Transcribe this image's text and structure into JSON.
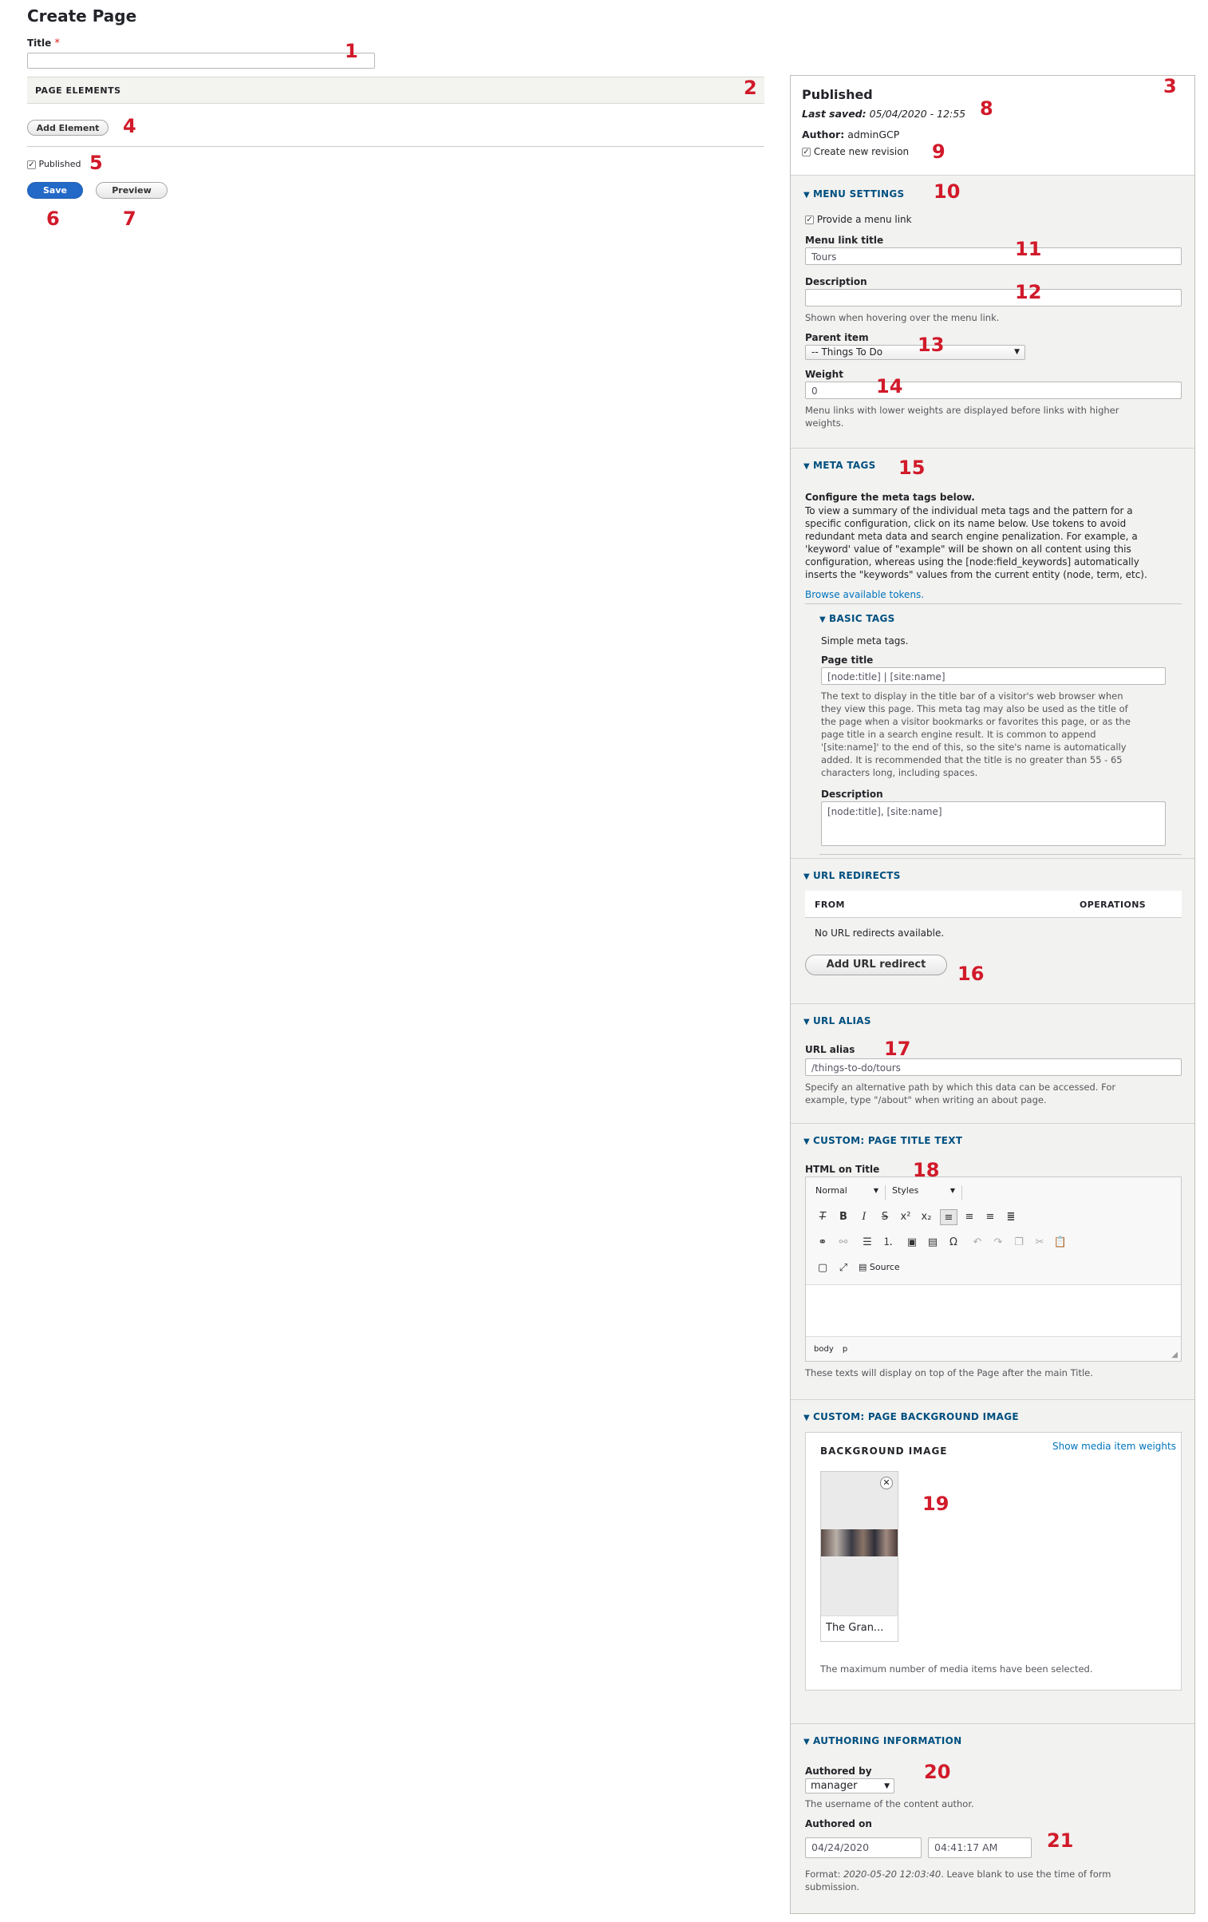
{
  "page": {
    "title": "Create Page",
    "title_label": "Title",
    "required_mark": "*",
    "page_elements_label": "PAGE ELEMENTS",
    "add_element_label": "Add Element",
    "published_label": "Published",
    "published_checked": true,
    "save_label": "Save",
    "preview_label": "Preview"
  },
  "meta": {
    "status": "Published",
    "last_saved_label": "Last saved:",
    "last_saved_value": "05/04/2020 - 12:55",
    "author_label": "Author:",
    "author_value": "adminGCP",
    "revision_label": "Create new revision",
    "revision_checked": true
  },
  "menu": {
    "section_label": "MENU SETTINGS",
    "provide_link_label": "Provide a menu link",
    "provide_link_checked": true,
    "link_title_label": "Menu link title",
    "link_title_value": "Tours",
    "description_label": "Description",
    "description_value": "",
    "description_help": "Shown when hovering over the menu link.",
    "parent_label": "Parent item",
    "parent_value": "-- Things To Do",
    "weight_label": "Weight",
    "weight_value": "0",
    "weight_help_1": "Menu links with lower weights are displayed before links with higher",
    "weight_help_2": "weights."
  },
  "metatags": {
    "section_label": "META TAGS",
    "intro_title": "Configure the meta tags below.",
    "intro_lines": [
      "To view a summary of the individual meta tags and the pattern for a",
      "specific configuration, click on its name below. Use tokens to avoid",
      "redundant meta data and search engine penalization. For example, a",
      "'keyword' value of \"example\" will be shown on all content using this",
      "configuration, whereas using the [node:field_keywords] automatically",
      "inserts the \"keywords\" values from the current entity (node, term, etc)."
    ],
    "browse_tokens": "Browse available tokens.",
    "basic_tags_label": "BASIC TAGS",
    "basic_tags_desc": "Simple meta tags.",
    "page_title_label": "Page title",
    "page_title_value": "[node:title] | [site:name]",
    "page_title_help": [
      "The text to display in the title bar of a visitor's web browser when",
      "they view this page. This meta tag may also be used as the title of",
      "the page when a visitor bookmarks or favorites this page, or as the",
      "page title in a search engine result. It is common to append",
      "'[site:name]' to the end of this, so the site's name is automatically",
      "added. It is recommended that the title is no greater than 55 - 65",
      "characters long, including spaces."
    ],
    "description_label": "Description",
    "description_value": "[node:title], [site:name]"
  },
  "redirects": {
    "section_label": "URL REDIRECTS",
    "col_from": "FROM",
    "col_operations": "OPERATIONS",
    "empty_text": "No URL redirects available.",
    "add_label": "Add URL redirect"
  },
  "alias": {
    "section_label": "URL ALIAS",
    "label": "URL alias",
    "value": "/things-to-do/tours",
    "help_1": "Specify an alternative path by which this data can be accessed. For",
    "help_2": "example, type \"/about\" when writing an about page."
  },
  "titletext": {
    "section_label": "CUSTOM: PAGE TITLE TEXT",
    "label": "HTML on Title",
    "format_value": "Normal",
    "styles_value": "Styles",
    "source_label": "Source",
    "path_body": "body",
    "path_p": "p",
    "help": "These texts will display on top of the Page after the main Title."
  },
  "bgimage": {
    "section_label": "CUSTOM: PAGE BACKGROUND IMAGE",
    "label": "BACKGROUND IMAGE",
    "weights_link": "Show media item weights",
    "item_name": "The Gran...",
    "max_text": "The maximum number of media items have been selected."
  },
  "authoring": {
    "section_label": "AUTHORING INFORMATION",
    "authored_by_label": "Authored by",
    "authored_by_value": "manager",
    "authored_by_help": "The username of the content author.",
    "authored_on_label": "Authored on",
    "date_value": "04/24/2020",
    "time_value": "04:41:17 AM",
    "format_label": "Format:",
    "format_value": "2020-05-20 12:03:40",
    "format_rest": ". Leave blank to use the time of form",
    "format_rest_2": "submission."
  },
  "callouts": [
    "1",
    "2",
    "3",
    "4",
    "5",
    "6",
    "7",
    "8",
    "9",
    "10",
    "11",
    "12",
    "13",
    "14",
    "15",
    "16",
    "17",
    "18",
    "19",
    "20",
    "21"
  ]
}
